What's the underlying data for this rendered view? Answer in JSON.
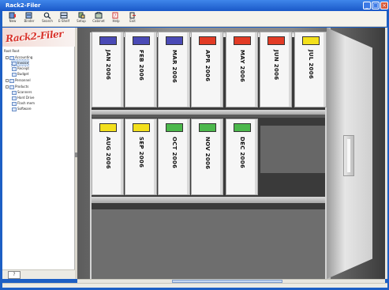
{
  "window": {
    "title": "Rack2-Filer",
    "controls": [
      "_",
      "□",
      "×"
    ]
  },
  "toolbar": {
    "buttons": [
      {
        "label": "New",
        "icon": "new-binder-icon"
      },
      {
        "label": "Binder",
        "icon": "binder-icon"
      },
      {
        "label": "Search",
        "icon": "search-icon"
      },
      {
        "label": "E-Shelf",
        "icon": "e-shelf-icon"
      },
      {
        "label": "Setup",
        "icon": "setup-icon"
      },
      {
        "label": "Cabinet",
        "icon": "cabinet-icon"
      },
      {
        "label": "Help",
        "icon": "help-icon"
      },
      {
        "label": "Exit",
        "icon": "exit-icon"
      }
    ]
  },
  "sidebar": {
    "logo": "Rack2-Filer",
    "tree": [
      {
        "label": "Root Root",
        "level": 0
      },
      {
        "label": "Accounting",
        "level": 1
      },
      {
        "label": "Invoice",
        "level": 2,
        "selected": true
      },
      {
        "label": "Receipt",
        "level": 2
      },
      {
        "label": "Budget",
        "level": 2
      },
      {
        "label": "Personnel",
        "level": 1
      },
      {
        "label": "Products",
        "level": 1
      },
      {
        "label": "Scanners",
        "level": 2
      },
      {
        "label": "Hard Drive",
        "level": 2
      },
      {
        "label": "Flash mem",
        "level": 2
      },
      {
        "label": "Software",
        "level": 2
      }
    ],
    "footer_button": "?"
  },
  "cabinet": {
    "shelves": [
      {
        "binders": [
          {
            "label": "JAN 2006",
            "color": "#4a4ab6"
          },
          {
            "label": "FEB 2006",
            "color": "#4a4ab6"
          },
          {
            "label": "MAR 2006",
            "color": "#4a4ab6"
          },
          {
            "label": "APR 2006",
            "color": "#e23b25"
          },
          {
            "label": "MAY 2006",
            "color": "#e23b25"
          },
          {
            "label": "JUN 2006",
            "color": "#e23b25"
          },
          {
            "label": "JUL 2006",
            "color": "#f3e01c"
          }
        ]
      },
      {
        "binders": [
          {
            "label": "AUG 2006",
            "color": "#f3e01c"
          },
          {
            "label": "SEP 2006",
            "color": "#f3e01c"
          },
          {
            "label": "OCT 2006",
            "color": "#4cb84c"
          },
          {
            "label": "NOV 2006",
            "color": "#4cb84c"
          },
          {
            "label": "DEC 2006",
            "color": "#4cb84c"
          }
        ]
      }
    ]
  }
}
